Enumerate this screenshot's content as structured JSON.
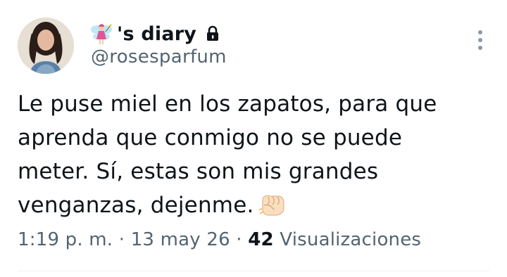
{
  "tweet": {
    "author": {
      "display_name": "'s diary",
      "name_emoji_icon": "fairy-emoji-icon",
      "protected_icon": "lock-icon",
      "handle": "@rosesparfum",
      "avatar": "avatar"
    },
    "text": {
      "line1": "Le puse miel en los zapatos, para que",
      "line2": "aprenda que conmigo no se puede",
      "line3": "meter. Sí, estas son mis grandes",
      "line4": "venganzas, dejenme.",
      "trailing_emoji_icon": "oncoming-fist-emoji-icon"
    },
    "meta": {
      "time": "1:19 p. m.",
      "separator1": " · ",
      "date": "13 may 26",
      "separator2": " · ",
      "views_count": "42",
      "views_label": " Visualizaciones"
    },
    "more_icon": "more-options-icon"
  },
  "colors": {
    "text_primary": "#0f1419",
    "text_secondary": "#536471",
    "divider": "#eff3f4"
  }
}
